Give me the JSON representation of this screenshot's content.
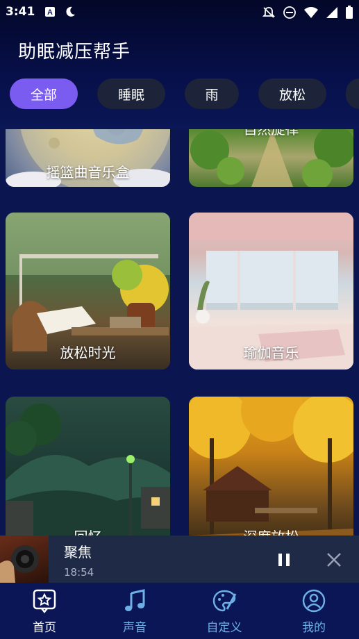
{
  "status_bar": {
    "time": "3:41",
    "left_icons": [
      "a-notification-icon",
      "moon-icon"
    ],
    "right_icons": [
      "notifications-off-icon",
      "do-not-disturb-icon",
      "wifi-icon",
      "signal-icon",
      "battery-icon"
    ]
  },
  "header": {
    "title": "助眠减压帮手"
  },
  "chips": [
    {
      "label": "全部",
      "active": true
    },
    {
      "label": "睡眠",
      "active": false
    },
    {
      "label": "雨",
      "active": false
    },
    {
      "label": "放松",
      "active": false
    }
  ],
  "cards": [
    {
      "label": "摇篮曲音乐盒"
    },
    {
      "label": "自然旋律"
    },
    {
      "label": "放松时光"
    },
    {
      "label": "瑜伽音乐"
    },
    {
      "label": "回忆"
    },
    {
      "label": "深度放松"
    }
  ],
  "player": {
    "title": "聚焦",
    "time": "18:54"
  },
  "nav": [
    {
      "label": "首页",
      "icon": "home-star-icon",
      "active": true
    },
    {
      "label": "声音",
      "icon": "music-note-icon",
      "active": false
    },
    {
      "label": "自定义",
      "icon": "palette-icon",
      "active": false
    },
    {
      "label": "我的",
      "icon": "profile-icon",
      "active": false
    }
  ],
  "colors": {
    "chip_active": "#7a5cf0",
    "chip_inactive": "#1d2338",
    "nav_inactive": "#6eb0e6",
    "background": "#0b1550"
  }
}
